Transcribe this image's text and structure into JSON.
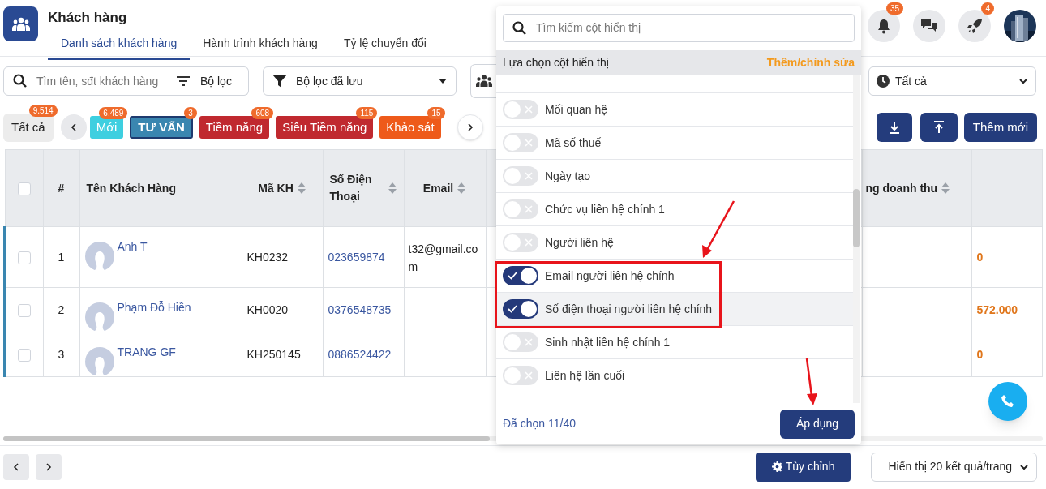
{
  "header": {
    "title": "Khách hàng",
    "tabs": [
      {
        "label": "Danh sách khách hàng",
        "selected": true
      },
      {
        "label": "Hành trình khách hàng",
        "selected": false
      },
      {
        "label": "Tỷ lệ chuyển đổi",
        "selected": false
      }
    ],
    "icons": [
      {
        "kind": "bell",
        "badge": "35"
      },
      {
        "kind": "chat"
      },
      {
        "kind": "rocket",
        "badge": "4"
      }
    ]
  },
  "toolbar": {
    "search": {
      "placeholder": "Tìm tên, sđt khách hàng"
    },
    "filter_button": "Bộ lọc",
    "saved_filter": "Bộ lọc đã lưu",
    "time_filter": "Tất cả"
  },
  "status_chips": [
    {
      "label": "Tất cả",
      "count": "9.514",
      "color": "#ececec",
      "selected": false
    },
    {
      "label": "Mới",
      "count": "6.489",
      "color": "#3ecfe0",
      "selected": false
    },
    {
      "label": "TƯ VẤN",
      "count": "3",
      "color": "#3a86b0",
      "selected": true
    },
    {
      "label": "Tiềm năng",
      "count": "608",
      "color": "#c0292f",
      "selected": false
    },
    {
      "label": "Siêu Tiềm năng",
      "count": "115",
      "color": "#c0292f",
      "selected": false
    },
    {
      "label": "Khảo sát",
      "count": "15",
      "color": "#ee5a1a",
      "selected": false
    }
  ],
  "actions": {
    "add_button": "Thêm mới"
  },
  "table": {
    "columns": [
      {
        "kind": "checkbox",
        "checked": false
      },
      {
        "kind": "text",
        "label": "#"
      },
      {
        "kind": "text",
        "label": "Tên Khách Hàng"
      },
      {
        "kind": "sort",
        "label": "Mã KH"
      },
      {
        "kind": "sort",
        "label": "Số Điện Thoại"
      },
      {
        "kind": "sort",
        "label": "Email"
      },
      {
        "kind": "sort",
        "label": "ng doanh thu"
      },
      {
        "kind": "blank"
      }
    ],
    "rows": [
      {
        "checked": false,
        "index": "1",
        "name": "Anh T",
        "code": "KH0232",
        "phone": "023659874",
        "email": "t32@gmail.com",
        "value": "0"
      },
      {
        "checked": false,
        "index": "2",
        "name": "Phạm Đỗ Hiền",
        "code": "KH0020",
        "phone": "0376548735",
        "value": "572.000"
      },
      {
        "checked": false,
        "index": "3",
        "name": "TRANG GF",
        "code": "KH250145",
        "phone": "0886524422",
        "value": "0"
      }
    ]
  },
  "column_picker": {
    "search": {
      "placeholder": "Tìm kiếm cột hiển thị"
    },
    "title": "Lựa chọn cột hiển thị",
    "edit_link": "Thêm/chỉnh sửa",
    "items": [
      {
        "label": "Mối quan hệ",
        "on": false,
        "highlighted": false
      },
      {
        "label": "Mã số thuế",
        "on": false,
        "highlighted": false
      },
      {
        "label": "Ngày tạo",
        "on": false,
        "highlighted": false
      },
      {
        "label": "Chức vụ liên hệ chính 1",
        "on": false,
        "highlighted": false
      },
      {
        "label": "Người liên hệ",
        "on": false,
        "highlighted": false
      },
      {
        "label": "Email người liên hệ chính",
        "on": true,
        "highlighted": false
      },
      {
        "label": "Số điện thoại người liên hệ chính",
        "on": true,
        "highlighted": true
      },
      {
        "label": "Sinh nhật liên hệ chính 1",
        "on": false,
        "highlighted": false
      },
      {
        "label": "Liên hệ lần cuối",
        "on": false,
        "highlighted": false
      }
    ],
    "selected_count": "Đã chọn 11/40",
    "apply_button": "Áp dụng"
  },
  "footer": {
    "customize_button": "Tùy chỉnh",
    "page_size": "Hiển thị 20 kết quả/trang"
  }
}
